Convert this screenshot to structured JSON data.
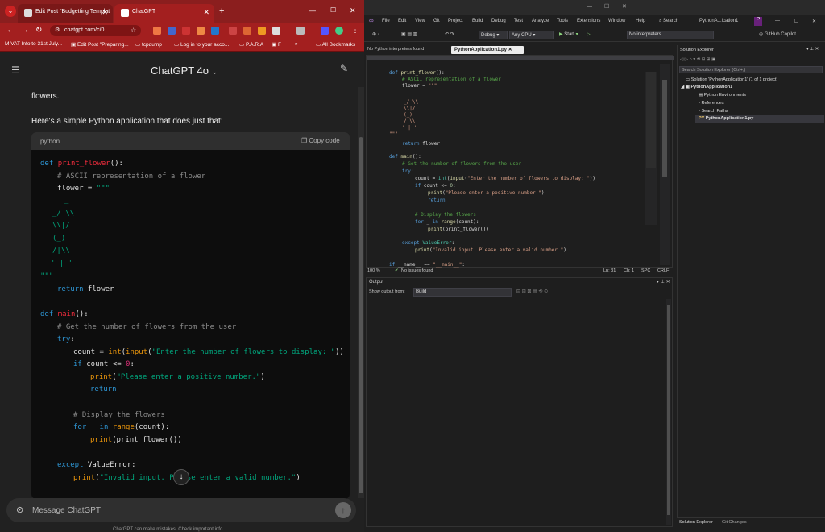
{
  "browser": {
    "tabs": [
      {
        "label": "Edit Post \"Budgetting Templat",
        "active": false
      },
      {
        "label": "ChatGPT",
        "active": true
      }
    ],
    "new_tab": "+",
    "window_controls": {
      "minimize": "—",
      "maximize": "☐",
      "close": "✕"
    },
    "url": "chatgpt.com/c/0...",
    "bookmarks": [
      "VAT Info to 31st July...",
      "Edit Post \"Preparing...",
      "tcpdump",
      "Log in to your acco...",
      "P.A.R.A",
      "F",
      "All Bookmarks"
    ],
    "bookmarks_more": "»"
  },
  "chat": {
    "title": "ChatGPT 4o",
    "intro_tail": "flowers.",
    "intro": "Here's a simple Python application that does just that:",
    "code_lang": "python",
    "copy_label": "Copy code",
    "message_placeholder": "Message ChatGPT",
    "disclaimer": "ChatGPT can make mistakes. Check important info."
  },
  "vs": {
    "menu": [
      "File",
      "Edit",
      "View",
      "Git",
      "Project",
      "Build",
      "Debug",
      "Test",
      "Analyze",
      "Tools",
      "Extensions",
      "Window",
      "Help"
    ],
    "search": "Search",
    "solution_title": "PythonA...ication1",
    "config": "Debug",
    "platform": "Any CPU",
    "start": "Start",
    "interpreter": "No interpreters",
    "copilot": "GitHub Copilot",
    "tab_left": "No Python interpreters found",
    "tab_active": "PythonApplication1.py",
    "zoom": "100 %",
    "issues": "No issues found",
    "ln": "Ln: 31",
    "ch": "Ch: 1",
    "spc": "SPC",
    "crlf": "CRLF",
    "output_title": "Output",
    "output_from_label": "Show output from:",
    "output_from": "Build",
    "se_title": "Solution Explorer",
    "se_search": "Search Solution Explorer (Ctrl+;)",
    "se_items": [
      "Solution 'PythonApplication1' (1 of 1 project)",
      "PythonApplication1",
      "Python Environments",
      "References",
      "Search Paths",
      "PythonApplication1.py"
    ],
    "se_bottom_tabs": [
      "Solution Explorer",
      "Git Changes"
    ]
  },
  "colors": {
    "chrome_tab": "#8b1e1e",
    "chrome_active": "#a31f1f",
    "vs_bg": "#1f1f1f"
  }
}
